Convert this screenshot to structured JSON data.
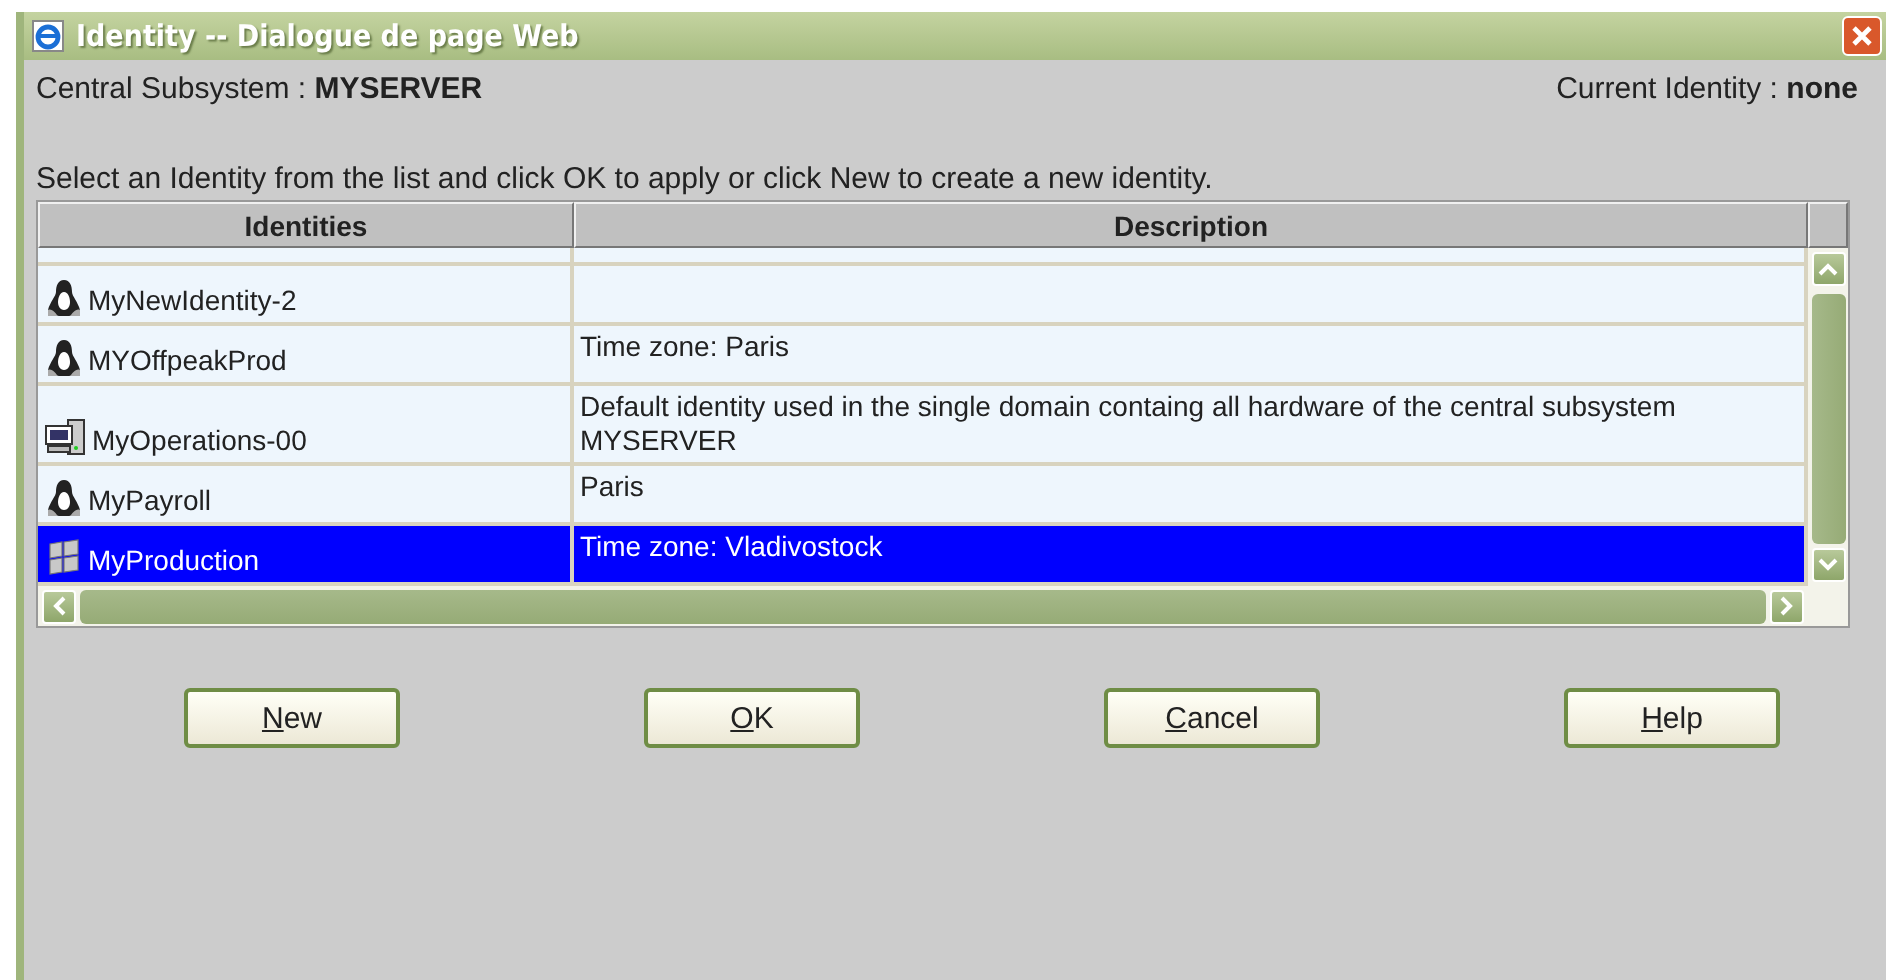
{
  "window": {
    "title": "Identity -- Dialogue de page Web"
  },
  "header": {
    "subsystem_label": "Central Subsystem : ",
    "subsystem": "MYSERVER",
    "identity_label": "Current Identity : ",
    "identity": "none"
  },
  "instruction": "Select an Identity from the list and click OK to apply or click New to create a new identity.",
  "table": {
    "columns": [
      "Identities",
      "Description"
    ],
    "rows": [
      {
        "kind": "penguin",
        "name": "MyNewIdentity-2",
        "description": "",
        "selected": false
      },
      {
        "kind": "penguin",
        "name": "MYOffpeakProd",
        "description": "Time zone: Paris",
        "selected": false
      },
      {
        "kind": "computer",
        "name": "MyOperations-00",
        "description": "Default identity used in the single domain containg all hardware of the central subsystem MYSERVER",
        "selected": false
      },
      {
        "kind": "penguin",
        "name": "MyPayroll",
        "description": "Paris",
        "selected": false
      },
      {
        "kind": "flag",
        "name": "MyProduction",
        "description": "Time zone: Vladivostock",
        "selected": true
      }
    ]
  },
  "buttons": [
    "New",
    "OK",
    "Cancel",
    "Help"
  ]
}
